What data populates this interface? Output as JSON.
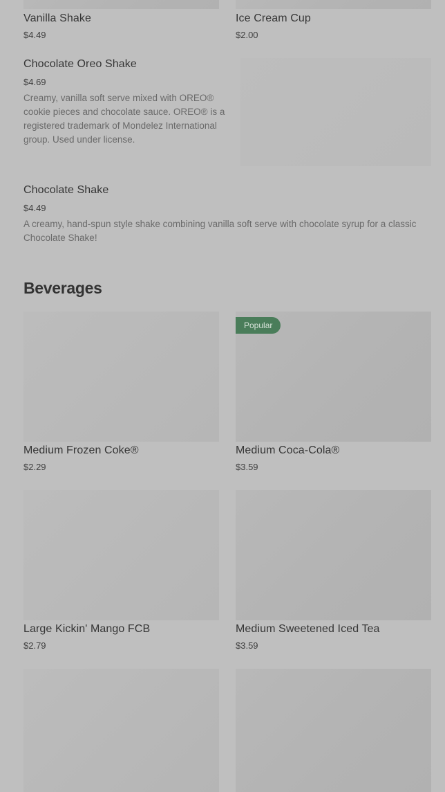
{
  "shakes": {
    "top_left": {
      "name": "Vanilla Shake",
      "price": "$4.49"
    },
    "top_right": {
      "name": "Ice Cream Cup",
      "price": "$2.00"
    },
    "oreo": {
      "name": "Chocolate Oreo Shake",
      "price": "$4.69",
      "description": "Creamy, vanilla soft serve mixed with OREO® cookie pieces and chocolate sauce. OREO® is a registered trademark of Mondelez International group. Used under license."
    },
    "chocolate": {
      "name": "Chocolate Shake",
      "price": "$4.49",
      "description": "A creamy, hand-spun style shake combining vanilla soft serve with chocolate syrup for a classic Chocolate Shake!"
    }
  },
  "beverages": {
    "title": "Beverages",
    "badge": "Popular",
    "items": [
      {
        "name": "Medium Frozen Coke®",
        "price": "$2.29"
      },
      {
        "name": "Medium Coca-Cola®",
        "price": "$3.59"
      },
      {
        "name": "Large Kickin' Mango FCB",
        "price": "$2.79"
      },
      {
        "name": "Medium Sweetened Iced Tea",
        "price": "$3.59"
      }
    ]
  },
  "colors": {
    "background": "#bfbfbf",
    "badge": "#4a7d5a",
    "image_placeholder": "#b5b5b5"
  }
}
